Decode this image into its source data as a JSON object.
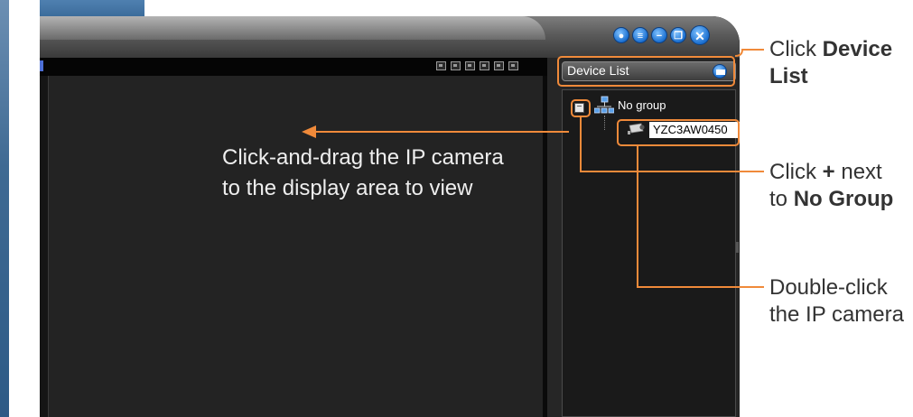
{
  "window": {
    "controls": [
      "lock",
      "menu",
      "minimize",
      "restore",
      "close"
    ],
    "accent_color": "#f08a3a"
  },
  "device_panel": {
    "title": "Device List",
    "tree": {
      "group": {
        "label": "No group",
        "expand_symbol": "−"
      },
      "camera": {
        "label": "YZC3AW0450"
      }
    }
  },
  "callouts": {
    "device_list": {
      "prefix": "Click ",
      "bold": "Device",
      "bold2": "List"
    },
    "expand_group": {
      "prefix": "Click ",
      "bold_plus": "+",
      "suffix": " next",
      "line2_prefix": "to ",
      "line2_bold": "No Group"
    },
    "double_click": {
      "line1": "Double-click",
      "line2": "the IP camera"
    },
    "drag": {
      "line1": "Click-and-drag the IP camera",
      "line2": "to the display area to view"
    }
  }
}
